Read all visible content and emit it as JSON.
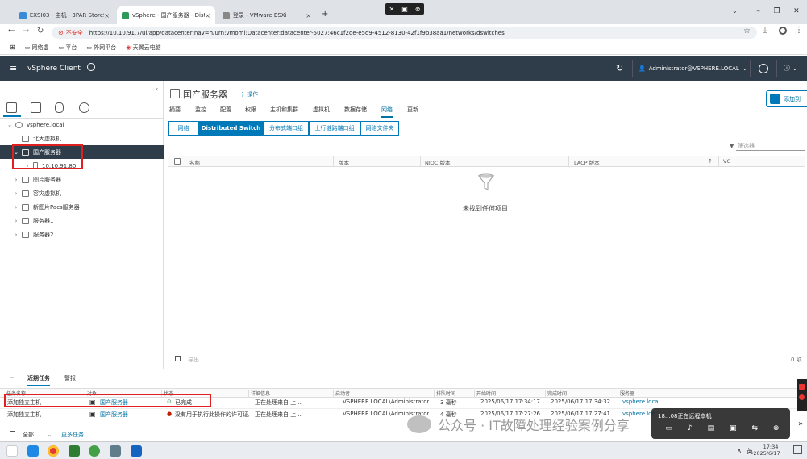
{
  "browser": {
    "tabs": [
      {
        "label": "EXSI03 - 主机 - 3PAR StoreSe"
      },
      {
        "label": "vSphere - 国产服务器 - Distrib"
      },
      {
        "label": "登录 - VMware ESXi"
      }
    ],
    "new_tab": "+",
    "not_secure": "不安全",
    "url": "https://10.10.91.7/ui/app/datacenter;nav=h/urn:vmomi:Datacenter:datacenter-5027:46c1f2de-e5d9-4512-8130-42f1f9b38aa1/networks/dswitches",
    "bookmarks": [
      "网络虚",
      "平台",
      "外网平台",
      "天翼云电脑"
    ]
  },
  "header": {
    "app_title": "vSphere Client",
    "user": "Administrator@VSPHERE.LOCAL"
  },
  "tree": {
    "items": [
      {
        "label": "vsphere.local",
        "level": 0
      },
      {
        "label": "北大虚拟机",
        "level": 1
      },
      {
        "label": "国产服务器",
        "level": 1
      },
      {
        "label": "10.10.91.80",
        "level": 2
      },
      {
        "label": "图片服务器",
        "level": 1
      },
      {
        "label": "容灾虚拟机",
        "level": 1
      },
      {
        "label": "新图片Pacs服务器",
        "level": 1
      },
      {
        "label": "服务器1",
        "level": 1
      },
      {
        "label": "服务器2",
        "level": 1
      }
    ]
  },
  "main": {
    "title": "国产服务器",
    "actions": "操作",
    "side_button": "添加到",
    "tabs": [
      "摘要",
      "监控",
      "配置",
      "权限",
      "主机和集群",
      "虚拟机",
      "数据存储",
      "网络",
      "更新"
    ],
    "segments": [
      "网络",
      "Distributed Switch",
      "分布式端口组",
      "上行链路端口组",
      "网络文件夹"
    ],
    "filter_placeholder": "筛选器",
    "columns": [
      "名称",
      "版本",
      "NIOC 版本",
      "LACP 版本",
      "VC"
    ],
    "empty_text": "未找到任何项目",
    "export": "导出",
    "count": "0 项"
  },
  "tasks": {
    "tabs": [
      "近期任务",
      "警报"
    ],
    "columns": [
      "任务名称",
      "对象",
      "状态",
      "详细信息",
      "启动者",
      "排队时间",
      "开始时间",
      "完成时间",
      "服务器"
    ],
    "rows": [
      {
        "name": "添加独立主机",
        "object": "国产服务器",
        "status": "已完成",
        "detail": "正在处理来自 上...",
        "initiator": "VSPHERE.LOCAL\\Administrator",
        "queue": "3 毫秒",
        "start": "2025/06/17 17:34:17",
        "end": "2025/06/17 17:34:32",
        "server": "vsphere.local"
      },
      {
        "name": "添加独立主机",
        "object": "国产服务器",
        "status": "没有用于执行此操作的许可证。",
        "detail": "正在处理来自 上...",
        "initiator": "VSPHERE.LOCAL\\Administrator",
        "queue": "4 毫秒",
        "start": "2025/06/17 17:27:26",
        "end": "2025/06/17 17:27:41",
        "server": "vsphere.loc"
      }
    ],
    "footer_filter": "全部",
    "more_tasks": "更多任务"
  },
  "overlay": {
    "watermark": "公众号 · IT故障处理经验案例分享",
    "remote_notice": "18...08正在远程本机"
  },
  "taskbar": {
    "ime": "英",
    "time": "17:34",
    "date": "2025/6/17"
  }
}
